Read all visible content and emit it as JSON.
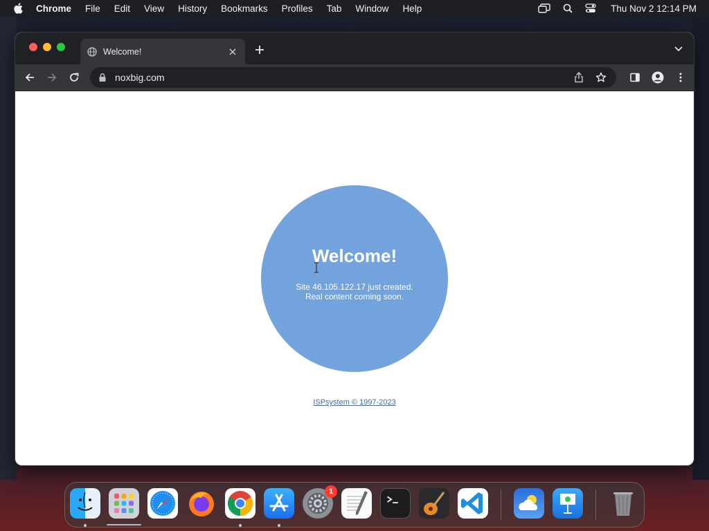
{
  "menubar": {
    "app_name": "Chrome",
    "items": [
      "File",
      "Edit",
      "View",
      "History",
      "Bookmarks",
      "Profiles",
      "Tab",
      "Window",
      "Help"
    ],
    "clock": "Thu Nov 2  12:14 PM"
  },
  "browser": {
    "tab": {
      "title": "Welcome!"
    },
    "omnibox": {
      "url": "noxbig.com"
    }
  },
  "page": {
    "heading": "Welcome!",
    "message_line1": "Site 46.105.122.17 just created.",
    "message_line2": "Real content coming soon.",
    "footer_link": "ISPsystem © 1997-2023",
    "circle_color": "#73a3dd"
  },
  "dock": {
    "apps": [
      {
        "name": "finder-icon",
        "running": true
      },
      {
        "name": "launchpad-icon",
        "running": false
      },
      {
        "name": "safari-icon",
        "running": false
      },
      {
        "name": "firefox-icon",
        "running": false
      },
      {
        "name": "chrome-icon",
        "running": true
      },
      {
        "name": "app-store-icon",
        "running": true
      },
      {
        "name": "system-settings-icon",
        "running": false
      },
      {
        "name": "textedit-icon",
        "running": false
      },
      {
        "name": "terminal-icon",
        "running": false
      },
      {
        "name": "garageband-icon",
        "running": false
      },
      {
        "name": "vscode-icon",
        "running": false
      },
      {
        "name": "weather-icon",
        "running": false
      },
      {
        "name": "keynote-icon",
        "running": false
      },
      {
        "name": "trash-icon",
        "running": false
      }
    ],
    "settings_badge": "1"
  }
}
